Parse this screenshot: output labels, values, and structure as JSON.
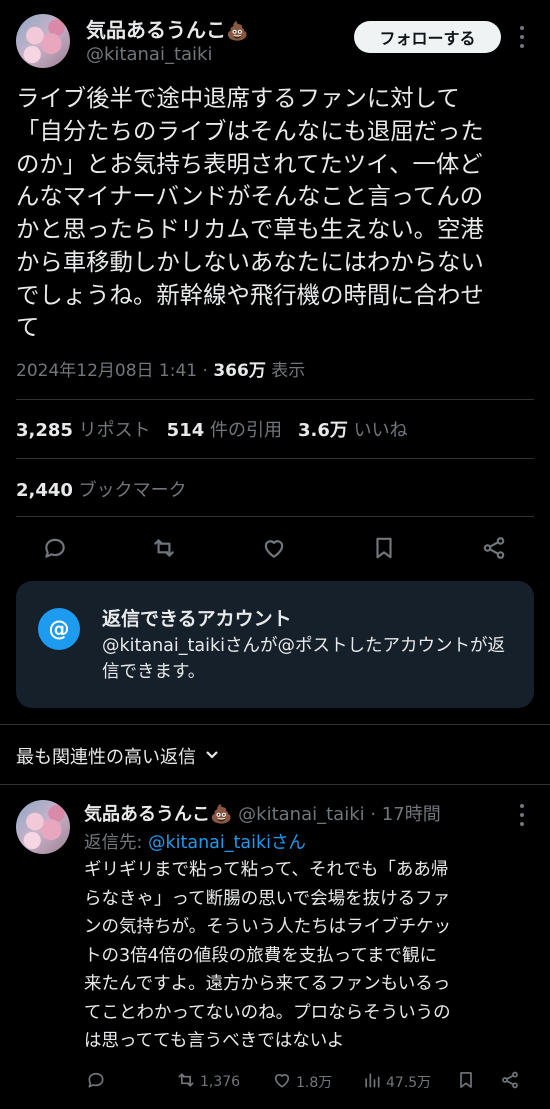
{
  "tweet": {
    "author_name": "気品あるうんこ",
    "author_emoji": "💩",
    "author_handle": "@kitanai_taiki",
    "follow_label": "フォローする",
    "text_lines": [
      "ライブ後半で途中退席するファンに対して",
      "「自分たちのライブはそんなにも退屈だった",
      "のか」とお気持ち表明されてたツイ、一体ど",
      "んなマイナーバンドがそんなこと言ってんの",
      "かと思ったらドリカムで草も生えない。空港",
      "から車移動しかしないあなたにはわからない",
      "でしょうね。新幹線や飛行機の時間に合わせ",
      "て"
    ],
    "timestamp": "2024年12月08日 1:41",
    "views_count": "366万",
    "views_label": "表示",
    "reposts_count": "3,285",
    "reposts_label": "リポスト",
    "quotes_count": "514",
    "quotes_label": "件の引用",
    "likes_count": "3.6万",
    "likes_label": "いいね",
    "bookmarks_count": "2,440",
    "bookmarks_label": "ブックマーク"
  },
  "reply_settings": {
    "icon": "@",
    "title": "返信できるアカウント",
    "description": "@kitanai_taikiさんが@ポストしたアカウントが返信できます。"
  },
  "sort": {
    "label": "最も関連性の高い返信"
  },
  "reply": {
    "author_name": "気品あるうんこ",
    "author_emoji": "💩",
    "author_handle": "@kitanai_taiki",
    "time": "· 17時間",
    "replying_to_label": "返信先:",
    "replying_to_handle": "@kitanai_taikiさん",
    "text_lines": [
      "ギリギリまで粘って粘って、それでも「ああ帰",
      "らなきゃ」って断腸の思いで会場を抜けるファ",
      "ンの気持ちが。そういう人たちはライブチケッ",
      "トの3倍4倍の値段の旅費を支払ってまで観に",
      "来たんですよ。遠方から来てるファンもいるっ",
      "てことわかってないのね。プロならそういうの",
      "は思ってても言うべきではないよ"
    ],
    "retweets": "1,376",
    "likes": "1.8万",
    "views": "47.5万"
  },
  "icons": {
    "reply": "reply-icon",
    "repost": "repost-icon",
    "like": "heart-icon",
    "bookmark": "bookmark-icon",
    "share": "share-icon",
    "views": "views-icon",
    "more": "more-icon",
    "chevron": "chevron-down-icon"
  },
  "colors": {
    "background": "#000000",
    "text": "#e7e9ea",
    "muted": "#71767b",
    "accent": "#1d9bf0",
    "card": "#16202a"
  }
}
